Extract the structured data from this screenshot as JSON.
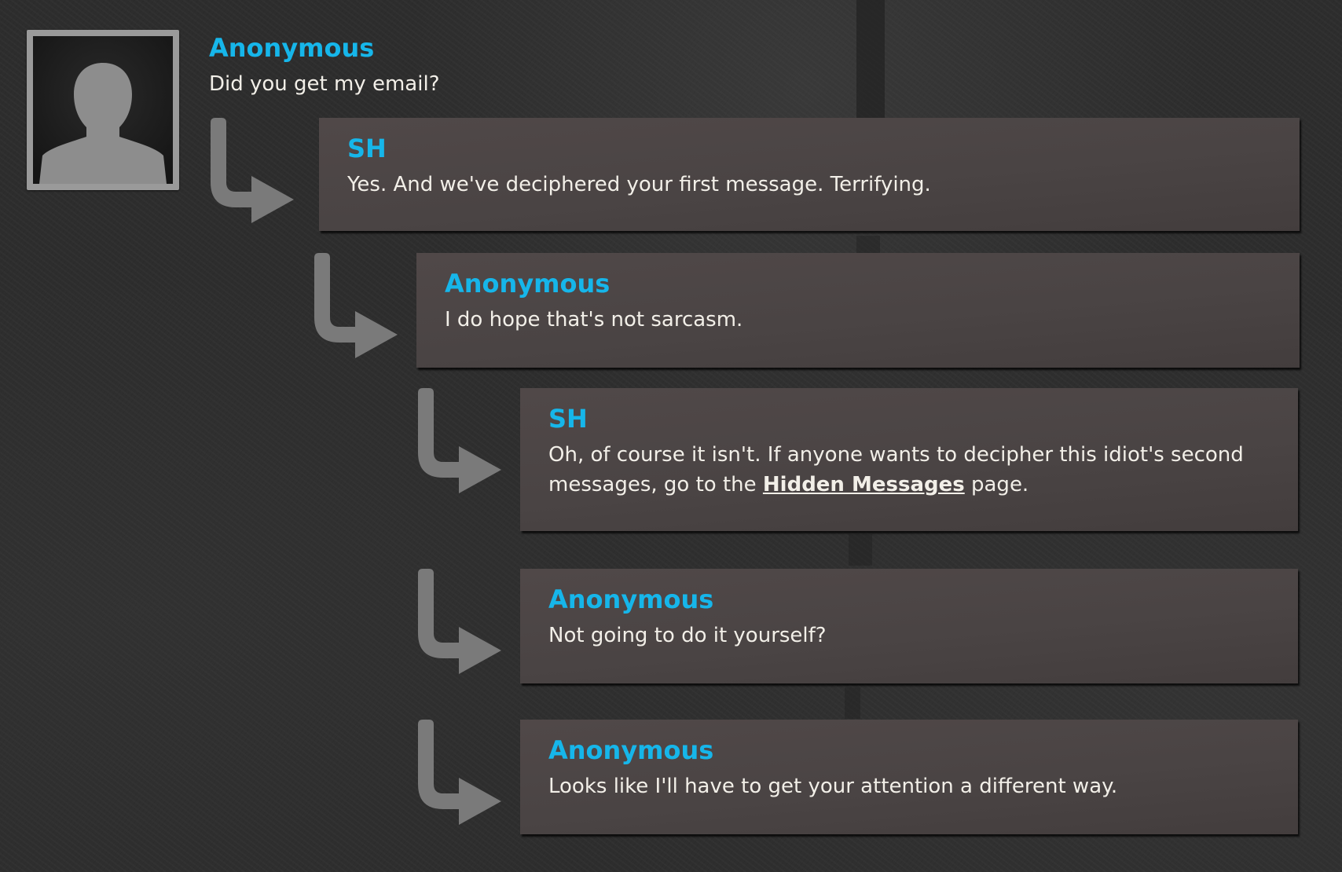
{
  "thread": {
    "top_post": {
      "author": "Anonymous",
      "text": "Did you get my email?"
    },
    "replies": [
      {
        "author": "SH",
        "text": "Yes. And we've deciphered your first message. Terrifying."
      },
      {
        "author": "Anonymous",
        "text": "I do hope that's not sarcasm."
      },
      {
        "author": "SH",
        "text_before": "Oh, of course it isn't. If anyone wants to decipher this idiot's second messages, go to the",
        "link": "Hidden Messages",
        "text_after": "page."
      },
      {
        "author": "Anonymous",
        "text": "Not going to do it yourself?"
      },
      {
        "author": "Anonymous",
        "text": "Looks like I'll have to get your attention a different way."
      }
    ]
  },
  "colors": {
    "author": "#16b6ea",
    "text": "#f2efe8",
    "bubble": "#4a4444",
    "background": "#2d2d2d",
    "arrow": "#7a7a7a"
  },
  "icons": {
    "avatar": "user-silhouette-icon",
    "reply": "reply-arrow-icon"
  }
}
